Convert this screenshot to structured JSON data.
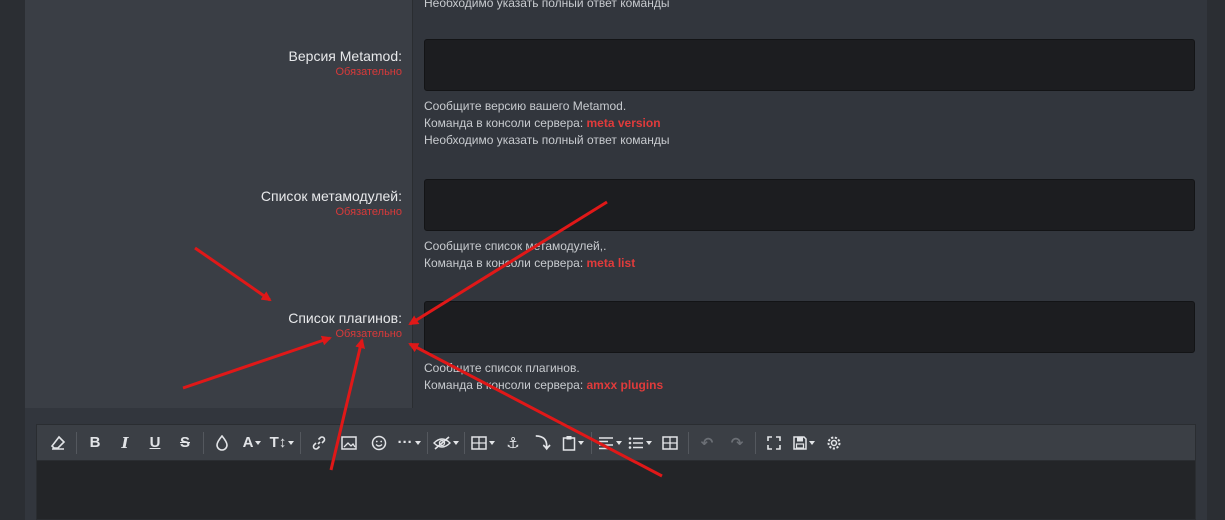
{
  "top_hint": "Необходимо указать полный ответ команды",
  "required_label": "Обязательно",
  "rows": [
    {
      "label": "Версия Metamod:",
      "hint_line1": "Сообщите версию вашего Metamod.",
      "cmd_prefix": "Команда в консоли сервера:",
      "cmd": "meta version",
      "hint_line3": "Необходимо указать полный ответ команды"
    },
    {
      "label": "Список метамодулей:",
      "hint_line1": "Сообщите список метамодулей,.",
      "cmd_prefix": "Команда в консоли сервера:",
      "cmd": "meta list"
    },
    {
      "label": "Список плагинов:",
      "hint_line1": "Сообщите список плагинов.",
      "cmd_prefix": "Команда в консоли сервера:",
      "cmd": "amxx plugins"
    }
  ],
  "toolbar": {
    "icons": [
      "eraser-icon",
      "bold-icon",
      "italic-icon",
      "underline-icon",
      "strikethrough-icon",
      "color-drop-icon",
      "font-family-icon",
      "font-size-icon",
      "link-icon",
      "image-icon",
      "smiley-icon",
      "more-icon",
      "hide-icon",
      "table-icon",
      "anchor-icon",
      "insert-icon",
      "paste-icon",
      "align-icon",
      "list-icon",
      "grid-icon",
      "undo-icon",
      "redo-icon",
      "fullscreen-icon",
      "save-draft-icon",
      "settings-icon"
    ]
  },
  "colors": {
    "required": "#d83a3a",
    "command": "#e03b3b",
    "arrow": "#e01818"
  }
}
